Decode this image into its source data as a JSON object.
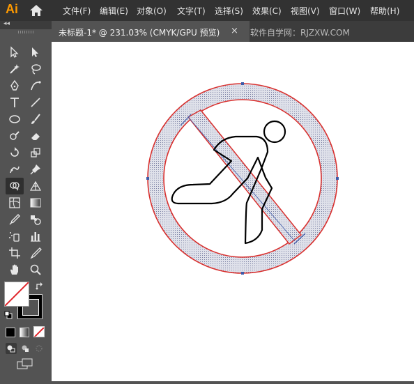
{
  "app": {
    "logo_text": "Ai",
    "brand_color": "#ff9a00"
  },
  "menu": [
    "文件(F)",
    "编辑(E)",
    "对象(O)",
    "文字(T)",
    "选择(S)",
    "效果(C)",
    "视图(V)",
    "窗口(W)",
    "帮助(H)"
  ],
  "tabs": {
    "active_label": "未标题-1* @ 231.03% (CMYK/GPU 预览)",
    "close_glyph": "×",
    "watermark": "软件自学网：RJZXW.COM"
  },
  "toolbar": {
    "collapse_glyph": "◂◂",
    "tools": [
      "selection-tool",
      "direct-selection-tool",
      "magic-wand-tool",
      "lasso-tool",
      "pen-tool",
      "curvature-tool",
      "type-tool",
      "line-segment-tool",
      "ellipse-tool",
      "paintbrush-tool",
      "shaper-tool",
      "eraser-tool",
      "rotate-tool",
      "scale-tool",
      "puppet-warp-tool",
      "pin-tool",
      "shape-builder-tool",
      "perspective-grid-tool",
      "mesh-tool",
      "gradient-tool",
      "eyedropper-tool",
      "blend-tool",
      "symbol-sprayer-tool",
      "column-graph-tool",
      "artboard-tool",
      "slice-tool",
      "hand-tool",
      "zoom-tool"
    ]
  },
  "colors": {
    "fill": "none",
    "stroke": "#000000",
    "ring_stroke": "#d9312f",
    "ring_fill": "#c7cad8",
    "selection": "#3f5ba9"
  }
}
